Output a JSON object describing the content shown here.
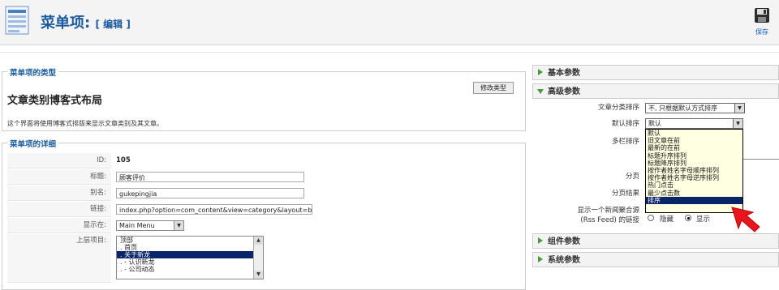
{
  "header": {
    "title": "菜单项:",
    "subtitle": "[ 编辑 ]",
    "save_label": "保存"
  },
  "type_section": {
    "legend": "菜单项的类型",
    "type_name": "文章类别博客式布局",
    "description": "这个界面将使用博客式排版来显示文章类别及其文章。",
    "change_button": "修改类型"
  },
  "details": {
    "legend": "菜单项的详细",
    "id_label": "ID:",
    "id_value": "105",
    "title_label": "标题:",
    "title_value": "顾客评价",
    "alias_label": "别名:",
    "alias_value": "gukepingjia",
    "link_label": "链接:",
    "link_value": "index.php?option=com_content&view=category&layout=b",
    "display_in_label": "显示在:",
    "display_in_value": "Main Menu",
    "parent_label": "上层项目:",
    "parent_items": [
      "顶部",
      ".  首页",
      ".  关于新龙",
      ".  - 认识新龙",
      ".  - 公司动态"
    ]
  },
  "right": {
    "basic_params": "基本参数",
    "advanced_params": "高级参数",
    "component_params": "组件参数",
    "system_params": "系统参数",
    "category_order_label": "文章分类排序",
    "category_order_value": "不, 只根据默认方式排序",
    "default_order_label": "默认排序",
    "default_order_value": "默认",
    "multi_col_label": "多栏排序",
    "pagination_label": "分页",
    "pagination_result_label": "分页结果",
    "rss_label_1": "显示一个新闻聚合源",
    "rss_label_2": "(Rss Feed) 的链接",
    "rss_hide": "隐藏",
    "rss_show": "显示",
    "order_options": [
      "默认",
      "旧文章在前",
      "最新的在前",
      "标题升序排列",
      "标题降序排列",
      "按作者姓名字母顺序排列",
      "按作者姓名字母逆序排列",
      "热门点击",
      "最少点击数",
      "排序"
    ],
    "highlighted_option_index": 9
  },
  "colors": {
    "title_blue": "#1a5b9e",
    "highlight": "#0a246a",
    "arrow_red": "#e8141f",
    "triangle_green": "#4c9b3a"
  }
}
